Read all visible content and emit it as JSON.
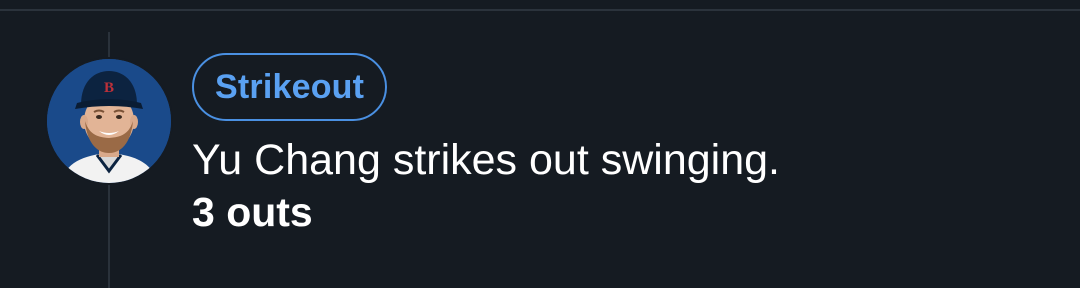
{
  "play": {
    "type_badge": "Strikeout",
    "description": "Yu Chang strikes out swinging.",
    "outs": "3 outs"
  },
  "player": {
    "avatar_icon": "player-headshot",
    "cap_logo": "B"
  },
  "colors": {
    "background": "#151b22",
    "badge_accent": "#4a90e2",
    "avatar_background": "#1a4a8a",
    "text": "#ffffff"
  }
}
